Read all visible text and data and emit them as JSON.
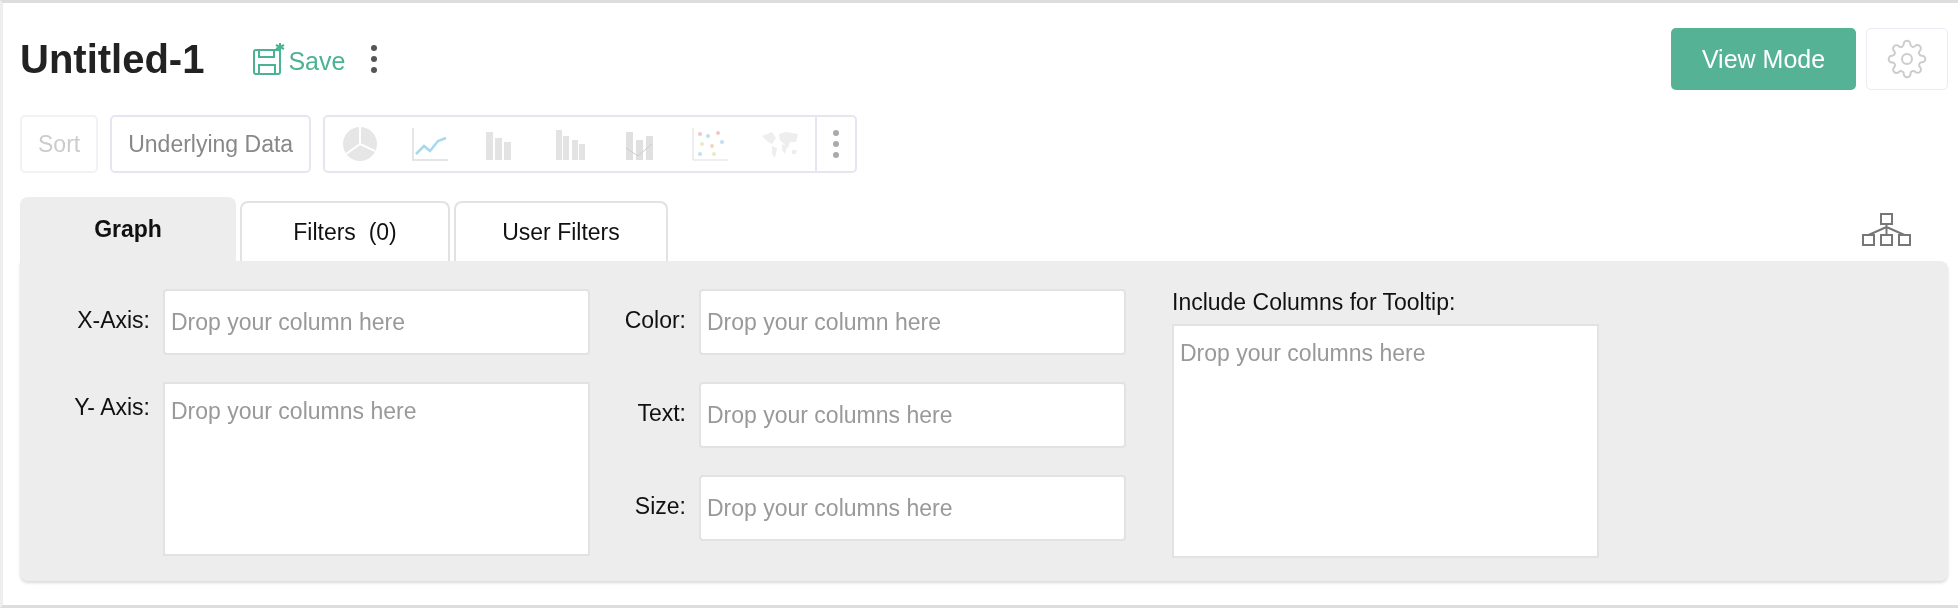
{
  "header": {
    "title": "Untitled-1",
    "save_label": "Save",
    "view_mode_label": "View Mode"
  },
  "toolbar": {
    "buttons": [
      {
        "label": "Sort",
        "disabled": true
      },
      {
        "label": "Underlying Data",
        "disabled": false
      }
    ]
  },
  "tabs": [
    {
      "label": "Graph",
      "selected": true
    },
    {
      "label": "Filters  (0)",
      "selected": false
    },
    {
      "label": "User Filters",
      "selected": false
    }
  ],
  "axes": [
    {
      "label": "X-Axis:",
      "placeholder": "Drop your column here",
      "kind": "single"
    },
    {
      "label": "Y- Axis:",
      "placeholder": "Drop your columns here",
      "kind": "multi"
    }
  ],
  "encodings": [
    {
      "label": "Color:",
      "placeholder": "Drop your column here"
    },
    {
      "label": "Text:",
      "placeholder": "Drop your columns here"
    },
    {
      "label": "Size:",
      "placeholder": "Drop your columns here"
    }
  ],
  "tooltip": {
    "label": "Include Columns for Tooltip:",
    "placeholder": "Drop your columns here"
  }
}
